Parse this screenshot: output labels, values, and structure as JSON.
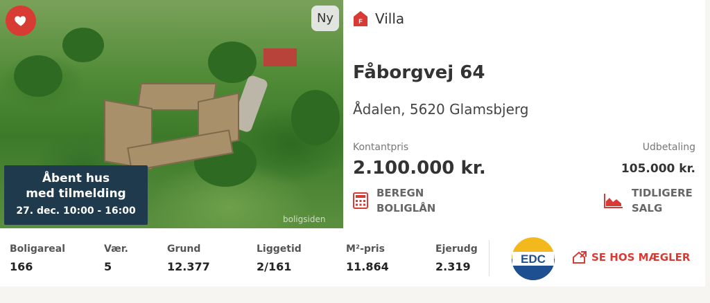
{
  "listing": {
    "favorite_icon": "heart-icon",
    "badge_new": "Ny",
    "open_house": {
      "line1": "Åbent hus",
      "line2": "med tilmelding",
      "time": "27. dec. 10:00 - 16:00"
    },
    "watermark": "boligsiden",
    "type_icon_letter": "F",
    "type_label": "Villa",
    "street": "Fåborgvej 64",
    "city": "Ådalen, 5620 Glamsbjerg",
    "price_label": "Kontantpris",
    "price": "2.100.000 kr.",
    "down_payment_label": "Udbetaling",
    "down_payment": "105.000 kr.",
    "calc_link": {
      "line1": "BEREGN",
      "line2": "BOLIGLÅN",
      "icon": "calculator-icon"
    },
    "history_link": {
      "line1": "TIDLIGERE",
      "line2": "SALG",
      "icon": "area-chart-icon"
    }
  },
  "stats": [
    {
      "label": "Boligareal",
      "value": "166"
    },
    {
      "label": "Vær.",
      "value": "5"
    },
    {
      "label": "Grund",
      "value": "12.377"
    },
    {
      "label": "Liggetid",
      "value": "2/161"
    },
    {
      "label": "M²-pris",
      "value": "11.864"
    },
    {
      "label": "Ejerudg",
      "value": "2.319"
    }
  ],
  "realtor": {
    "logo_text": "EDC",
    "button_label": "SE HOS MÆGLER",
    "button_icon": "external-house-icon"
  },
  "colors": {
    "accent": "#d83a34",
    "open_house_bg": "#1e3a4c",
    "edc_blue": "#1d4f91",
    "edc_yellow": "#f3b81b"
  }
}
